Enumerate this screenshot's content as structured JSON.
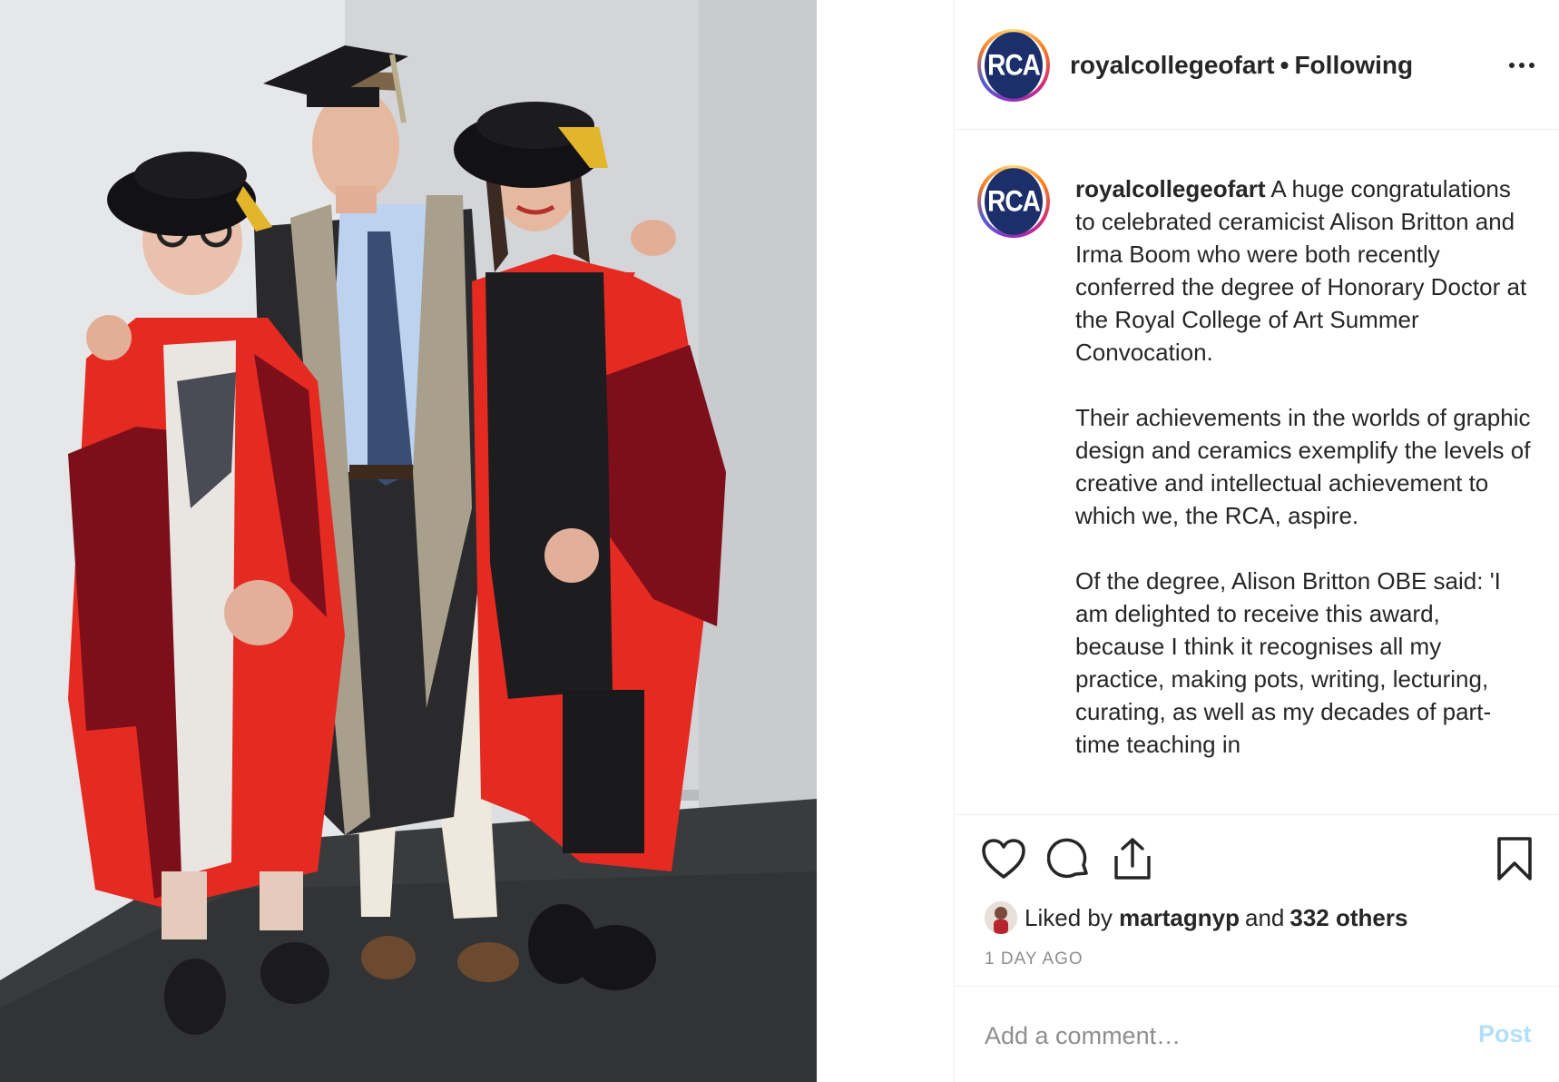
{
  "header": {
    "avatar_text": "RCA",
    "username": "royalcollegeofart",
    "separator": "•",
    "follow_status": "Following"
  },
  "caption": {
    "avatar_text": "RCA",
    "username": "royalcollegeofart",
    "paragraph1": "A huge congratulations to celebrated ceramicist Alison Britton and Irma Boom who were both recently conferred the degree of Honorary Doctor at the Royal College of Art Summer Convocation.",
    "paragraph2": "Their achievements in the worlds of graphic design and ceramics exemplify the levels of creative and intellectual achievement to which we, the RCA, aspire.",
    "paragraph3": "Of the degree, Alison Britton OBE said: 'I am delighted to receive this award, because I think it recognises all my practice, making pots, writing, lecturing, curating, as well as my decades of part-time teaching in"
  },
  "actions": {
    "icons": [
      "heart-icon",
      "comment-icon",
      "share-icon",
      "bookmark-icon"
    ]
  },
  "likes": {
    "prefix": "Liked by",
    "user": "martagnyp",
    "joiner": "and",
    "others": "332 others"
  },
  "timestamp": "1 DAY AGO",
  "comment_box": {
    "placeholder": "Add a comment…",
    "post_label": "Post"
  },
  "colors": {
    "accent_blue": "#0095f6",
    "post_disabled": "#b2dffc",
    "rca_navy": "#1d2f6b"
  }
}
